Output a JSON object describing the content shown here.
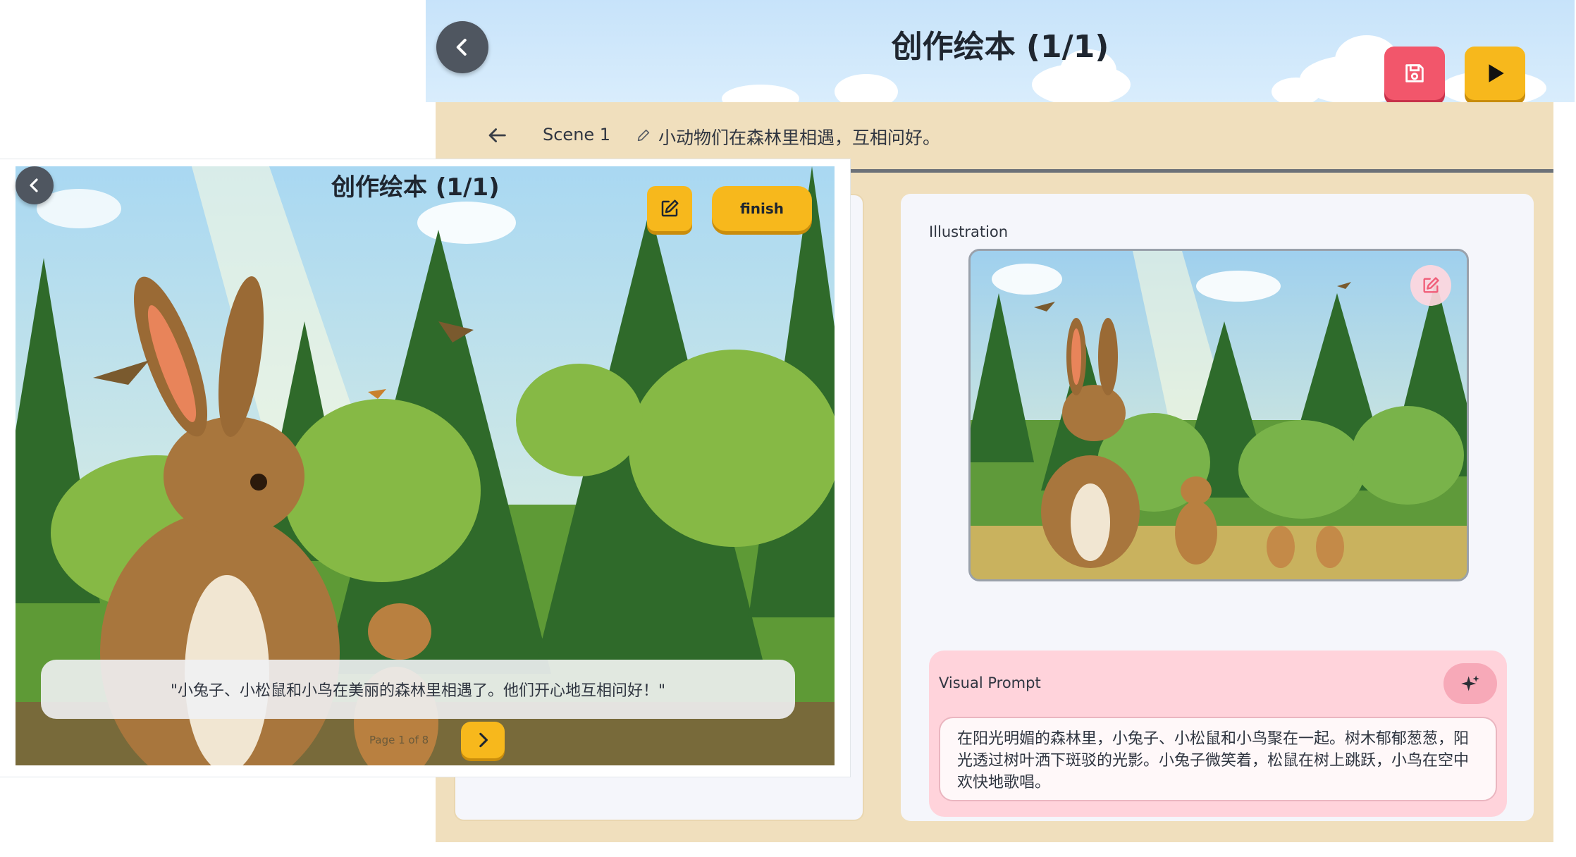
{
  "editor": {
    "title": "创作绘本 (1/1)",
    "back_icon": "chevron-left-icon",
    "save_icon": "save-icon",
    "play_icon": "play-icon",
    "scene_bar": {
      "back_icon": "arrow-left-icon",
      "scene_label": "Scene 1",
      "edit_icon": "pencil-icon",
      "description": "小动物们在森林里相遇，互相问好。"
    },
    "illustration": {
      "label": "Illustration",
      "edit_icon": "edit-icon"
    },
    "visual_prompt": {
      "label": "Visual Prompt",
      "magic_icon": "sparkle-icon",
      "text": "在阳光明媚的森林里，小兔子、小松鼠和小鸟聚在一起。树木郁郁葱葱，阳光透过树叶洒下斑驳的光影。小兔子微笑着，松鼠在树上跳跃，小鸟在空中欢快地歌唱。"
    },
    "colors": {
      "save_button": "#f2566b",
      "play_button": "#f7b81c",
      "panel_bg": "#f0dfbd",
      "prompt_bg": "#ffd3db"
    }
  },
  "player": {
    "title": "创作绘本 (1/1)",
    "back_icon": "chevron-left-icon",
    "edit_icon": "edit-icon",
    "finish_label": "finish",
    "caption": "\"小兔子、小松鼠和小鸟在美丽的森林里相遇了。他们开心地互相问好！\"",
    "page_indicator": "Page 1 of 8",
    "next_icon": "chevron-right-icon",
    "colors": {
      "accent": "#f7b81c"
    }
  }
}
